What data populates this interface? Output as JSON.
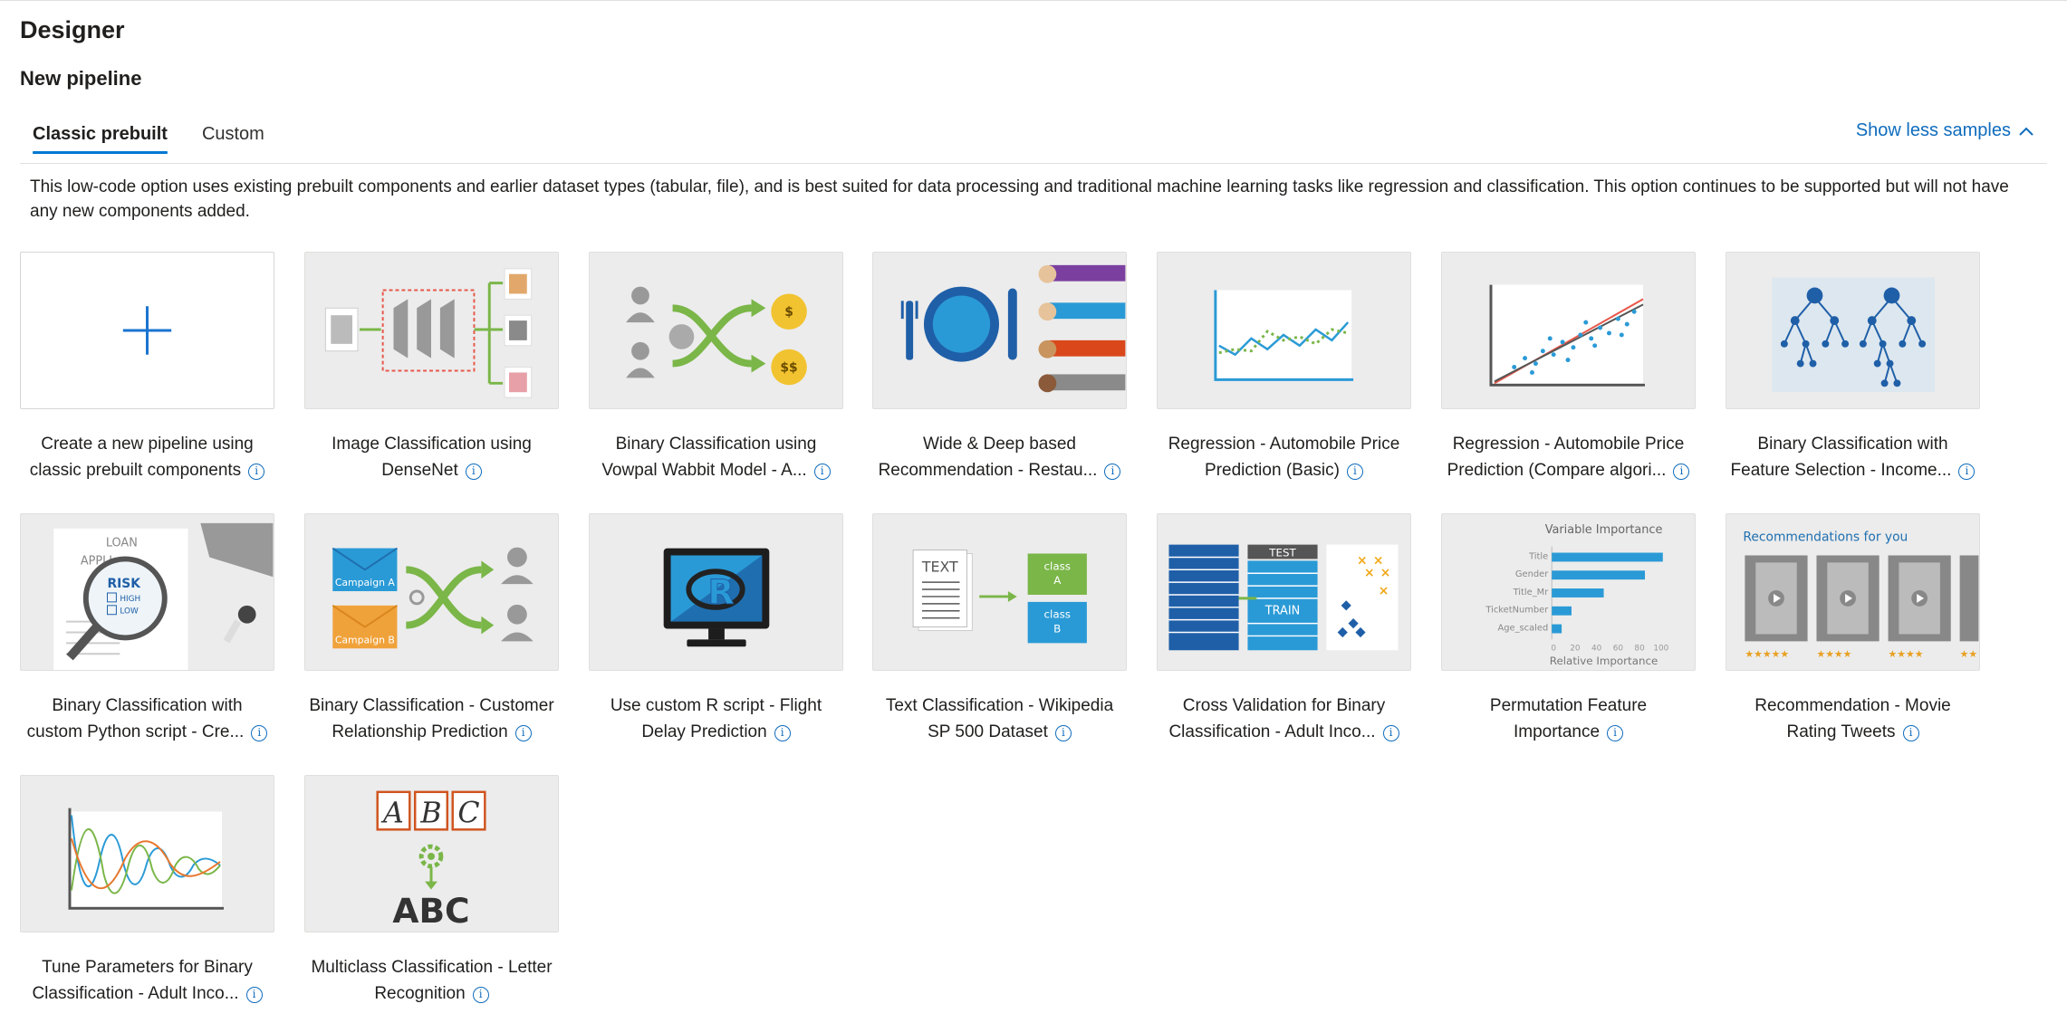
{
  "header": {
    "title": "Designer",
    "subtitle": "New pipeline"
  },
  "tabs": [
    {
      "label": "Classic prebuilt",
      "active": true
    },
    {
      "label": "Custom",
      "active": false
    }
  ],
  "show_less": {
    "label": "Show less samples",
    "icon": "chevron-up-icon"
  },
  "description": "This low-code option uses existing prebuilt components and earlier dataset types (tabular, file), and is best suited for data processing and traditional machine learning tasks like regression and classification. This option continues to be supported but will not have any new components added.",
  "cards": [
    {
      "line1": "Create a new pipeline using",
      "line2": "classic prebuilt components",
      "icon": "plus-icon"
    },
    {
      "line1": "Image Classification using",
      "line2": "DenseNet",
      "icon": "image-classification-icon"
    },
    {
      "line1": "Binary Classification using",
      "line2": "Vowpal Wabbit Model - A...",
      "icon": "binary-classification-icon"
    },
    {
      "line1": "Wide & Deep based",
      "line2": "Recommendation - Restau...",
      "icon": "restaurant-recommendation-icon"
    },
    {
      "line1": "Regression - Automobile Price",
      "line2": "Prediction (Basic)",
      "icon": "line-chart-icon"
    },
    {
      "line1": "Regression - Automobile Price",
      "line2": "Prediction (Compare algori...",
      "icon": "scatter-regression-icon"
    },
    {
      "line1": "Binary Classification with",
      "line2": "Feature Selection - Income...",
      "icon": "decision-tree-icon"
    },
    {
      "line1": "Binary Classification with",
      "line2": "custom Python script - Cre...",
      "icon": "loan-risk-icon",
      "thumb_text": {
        "loan": "LOAN",
        "appli": "APPLI",
        "risk": "RISK",
        "high": "HIGH",
        "low": "LOW"
      }
    },
    {
      "line1": "Binary Classification - Customer",
      "line2": "Relationship Prediction",
      "icon": "campaign-icon",
      "thumb_text": {
        "a": "Campaign A",
        "b": "Campaign B"
      }
    },
    {
      "line1": "Use custom R script - Flight",
      "line2": "Delay Prediction",
      "icon": "r-monitor-icon",
      "thumb_text": {
        "r": "R"
      }
    },
    {
      "line1": "Text Classification - Wikipedia",
      "line2": "SP 500 Dataset",
      "icon": "text-classification-icon",
      "thumb_text": {
        "text": "TEXT",
        "class_a1": "class",
        "class_a2": "A",
        "class_b1": "class",
        "class_b2": "B"
      }
    },
    {
      "line1": "Cross Validation for Binary",
      "line2": "Classification - Adult Inco...",
      "icon": "cross-validation-icon",
      "thumb_text": {
        "test": "TEST",
        "train": "TRAIN"
      }
    },
    {
      "line1": "Permutation Feature",
      "line2": "Importance",
      "icon": "feature-importance-icon",
      "thumb_text": {
        "title": "Variable Importance",
        "xtitle": "Relative Importance",
        "rows": [
          "Title",
          "Gender",
          "Title_Mr",
          "TicketNumber",
          "Age_scaled"
        ],
        "ticks": [
          "0",
          "20",
          "40",
          "60",
          "80",
          "100"
        ]
      }
    },
    {
      "line1": "Recommendation - Movie",
      "line2": "Rating Tweets",
      "icon": "movie-recommendation-icon",
      "thumb_text": {
        "title": "Recommendations for you"
      }
    },
    {
      "line1": "Tune Parameters for Binary",
      "line2": "Classification - Adult Inco...",
      "icon": "wave-chart-icon"
    },
    {
      "line1": "Multiclass Classification - Letter",
      "line2": "Recognition",
      "icon": "letter-recognition-icon",
      "thumb_text": {
        "a": "A",
        "b": "B",
        "c": "C",
        "abc": "ABC"
      }
    }
  ],
  "colors": {
    "accent": "#0078d4",
    "link": "#0f6cbd",
    "thumb_bg": "#ececec",
    "green": "#7ab648",
    "blue": "#2a9ad6",
    "orange": "#e8772e"
  }
}
